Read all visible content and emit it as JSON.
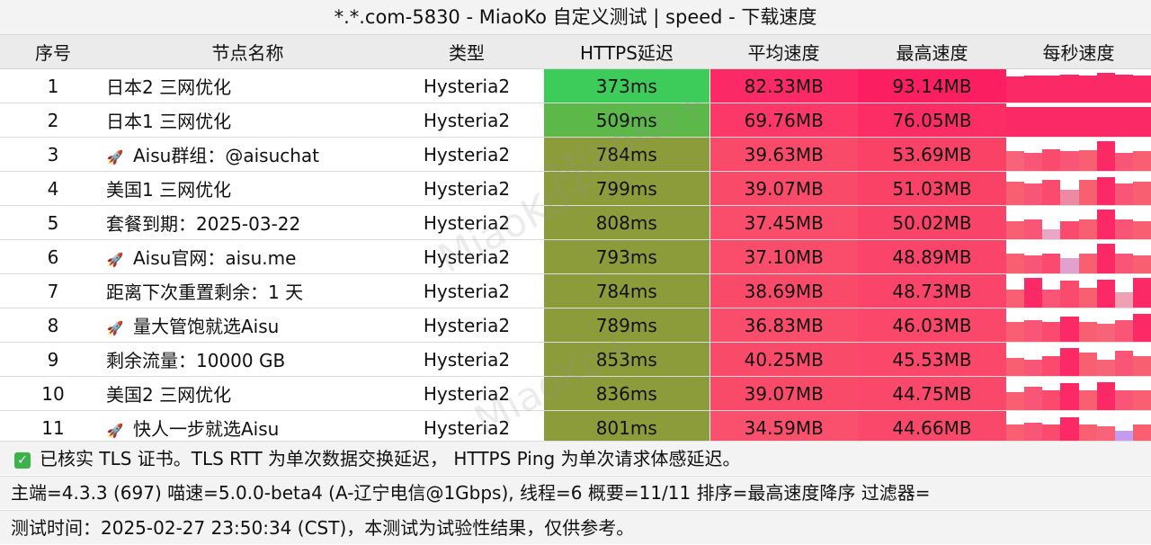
{
  "window": {
    "title": "*.*.com-5830 - MiaoKo 自定义测试 | speed - 下载速度"
  },
  "columns": [
    "序号",
    "节点名称",
    "类型",
    "HTTPS延迟",
    "平均速度",
    "最高速度",
    "每秒速度"
  ],
  "rows": [
    {
      "idx": "1",
      "name": "日本2 三网优化",
      "rocket": false,
      "type": "Hysteria2",
      "latency": "373ms",
      "avg": "82.33MB",
      "max": "93.14MB",
      "lat_color": "#3dcc5a",
      "avg_color": "#fb2a66",
      "max_color": "#fb1f62",
      "spark": [
        0.78,
        0.82,
        0.8,
        0.85,
        0.82,
        0.9,
        0.84,
        0.8
      ],
      "spark_colors": [
        "#fb2a66",
        "#fb2a66",
        "#fb2a66",
        "#fb2a66",
        "#fb2a66",
        "#fb2a66",
        "#fb2a66",
        "#fb2a66"
      ]
    },
    {
      "idx": "2",
      "name": "日本1 三网优化",
      "rocket": false,
      "type": "Hysteria2",
      "latency": "509ms",
      "avg": "69.76MB",
      "max": "76.05MB",
      "lat_color": "#5cb848",
      "avg_color": "#fb3868",
      "max_color": "#fb2d64",
      "spark": [
        0.9,
        0.9,
        0.9,
        0.9,
        0.9,
        0.9,
        0.9,
        0.9
      ],
      "spark_colors": [
        "#fb2a66",
        "#fb2a66",
        "#fb2a66",
        "#fb2a66",
        "#fb2a66",
        "#fb2a66",
        "#fb2a66",
        "#fb2a66"
      ]
    },
    {
      "idx": "3",
      "name": "Aisu群组：@aisuchat",
      "rocket": true,
      "type": "Hysteria2",
      "latency": "784ms",
      "avg": "39.63MB",
      "max": "53.69MB",
      "lat_color": "#8c9c3a",
      "avg_color": "#fa4a6a",
      "max_color": "#fa4166",
      "spark": [
        0.6,
        0.55,
        0.65,
        0.6,
        0.62,
        0.9,
        0.55,
        0.6
      ],
      "spark_colors": [
        "#f7647a",
        "#f85577",
        "#fa4a6e",
        "#f85577",
        "#f86072",
        "#fb2a66",
        "#f85577",
        "#f86072"
      ]
    },
    {
      "idx": "4",
      "name": "美国1 三网优化",
      "rocket": false,
      "type": "Hysteria2",
      "latency": "799ms",
      "avg": "39.07MB",
      "max": "51.03MB",
      "lat_color": "#8c9c3a",
      "avg_color": "#fa4a6a",
      "max_color": "#fa4267",
      "spark": [
        0.7,
        0.65,
        0.75,
        0.45,
        0.75,
        0.85,
        0.65,
        0.7
      ],
      "spark_colors": [
        "#f86072",
        "#f85577",
        "#fa4a6e",
        "#ed8aa3",
        "#f86072",
        "#fb2a66",
        "#f85577",
        "#f86072"
      ]
    },
    {
      "idx": "5",
      "name": "套餐到期：2025-03-22",
      "rocket": false,
      "type": "Hysteria2",
      "latency": "808ms",
      "avg": "37.45MB",
      "max": "50.02MB",
      "lat_color": "#8c9c3a",
      "avg_color": "#fa4c6b",
      "max_color": "#fa4368",
      "spark": [
        0.55,
        0.6,
        0.3,
        0.55,
        0.6,
        0.9,
        0.6,
        0.55
      ],
      "spark_colors": [
        "#f86072",
        "#f85577",
        "#e8a7c6",
        "#fa4a6e",
        "#f86072",
        "#fb2a66",
        "#f85577",
        "#f86072"
      ]
    },
    {
      "idx": "6",
      "name": "Aisu官网：aisu.me",
      "rocket": true,
      "type": "Hysteria2",
      "latency": "793ms",
      "avg": "37.10MB",
      "max": "48.89MB",
      "lat_color": "#8c9c3a",
      "avg_color": "#fa4c6b",
      "max_color": "#fa4469",
      "spark": [
        0.6,
        0.55,
        0.6,
        0.45,
        0.6,
        0.9,
        0.6,
        0.55
      ],
      "spark_colors": [
        "#f86072",
        "#f85577",
        "#fa4a6e",
        "#e2a0d0",
        "#f86072",
        "#fb2a66",
        "#f85577",
        "#f86072"
      ]
    },
    {
      "idx": "7",
      "name": "距离下次重置剩余：1 天",
      "rocket": false,
      "type": "Hysteria2",
      "latency": "784ms",
      "avg": "38.69MB",
      "max": "48.73MB",
      "lat_color": "#8c9c3a",
      "avg_color": "#fa4a6a",
      "max_color": "#fa4469",
      "spark": [
        0.55,
        0.9,
        0.55,
        0.8,
        0.6,
        0.85,
        0.45,
        0.9
      ],
      "spark_colors": [
        "#f86072",
        "#fb2a66",
        "#f85577",
        "#fa4a6e",
        "#f86072",
        "#fb2a66",
        "#f0a0b4",
        "#fb2a66"
      ]
    },
    {
      "idx": "8",
      "name": "量大管饱就选Aisu",
      "rocket": true,
      "type": "Hysteria2",
      "latency": "789ms",
      "avg": "36.83MB",
      "max": "46.03MB",
      "lat_color": "#8c9c3a",
      "avg_color": "#fa4d6c",
      "max_color": "#fa476a",
      "spark": [
        0.6,
        0.65,
        0.6,
        0.75,
        0.6,
        0.55,
        0.65,
        0.85
      ],
      "spark_colors": [
        "#f86072",
        "#f85577",
        "#fa4a6e",
        "#fb2a66",
        "#f86072",
        "#f7647a",
        "#f85577",
        "#fb2a66"
      ]
    },
    {
      "idx": "9",
      "name": "剩余流量：10000 GB",
      "rocket": false,
      "type": "Hysteria2",
      "latency": "853ms",
      "avg": "40.25MB",
      "max": "45.53MB",
      "lat_color": "#8c9c3a",
      "avg_color": "#fa4a6a",
      "max_color": "#fa476a",
      "spark": [
        0.55,
        0.5,
        0.6,
        0.85,
        0.7,
        0.5,
        0.75,
        0.6
      ],
      "spark_colors": [
        "#f86072",
        "#f85577",
        "#fa4a6e",
        "#fb2a66",
        "#f86072",
        "#f7647a",
        "#f85577",
        "#f86072"
      ]
    },
    {
      "idx": "10",
      "name": "美国2 三网优化",
      "rocket": false,
      "type": "Hysteria2",
      "latency": "836ms",
      "avg": "39.07MB",
      "max": "44.75MB",
      "lat_color": "#8c9c3a",
      "avg_color": "#fa4a6a",
      "max_color": "#fa486b",
      "spark": [
        0.55,
        0.7,
        0.6,
        0.8,
        0.6,
        0.85,
        0.6,
        0.6
      ],
      "spark_colors": [
        "#f86072",
        "#f85577",
        "#fa4a6e",
        "#fb2a66",
        "#f86072",
        "#fb2a66",
        "#f85577",
        "#f86072"
      ]
    },
    {
      "idx": "11",
      "name": "快人一步就选Aisu",
      "rocket": true,
      "type": "Hysteria2",
      "latency": "801ms",
      "avg": "34.59MB",
      "max": "44.66MB",
      "lat_color": "#8c9c3a",
      "avg_color": "#fa4f6d",
      "max_color": "#fa486b",
      "spark": [
        0.6,
        0.65,
        0.6,
        0.8,
        0.6,
        0.55,
        0.4,
        0.6
      ],
      "spark_colors": [
        "#f86072",
        "#f85577",
        "#fa4a6e",
        "#fb2a66",
        "#f86072",
        "#f7647a",
        "#c39cf0",
        "#f86072"
      ]
    }
  ],
  "footer": {
    "note": "已核实 TLS 证书。TLS RTT 为单次数据交换延迟， HTTPS Ping 为单次请求体感延迟。",
    "info": "主端=4.3.3 (697) 喵速=5.0.0-beta4 (A-辽宁电信@1Gbps), 线程=6 概要=11/11 排序=最高速度降序 过滤器=",
    "time": "测试时间：2025-02-27 23:50:34 (CST)，本测试为试验性结果，仅供参考。"
  },
  "watermark": "MiaoKo+",
  "icons": {
    "node_prefix": "rocket-icon",
    "note": "check-icon"
  }
}
